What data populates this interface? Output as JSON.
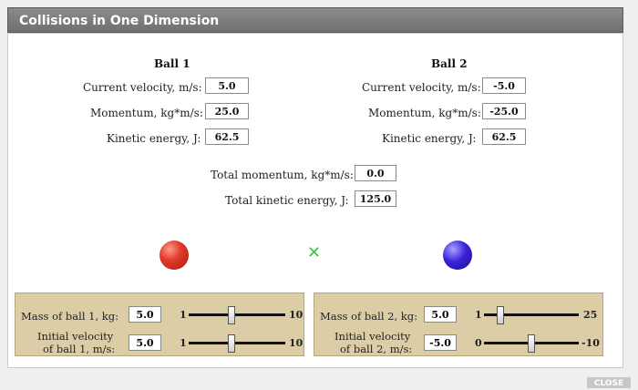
{
  "window": {
    "title": "Collisions in One Dimension"
  },
  "ball1": {
    "header": "Ball 1",
    "velocity_label": "Current velocity, m/s:",
    "velocity": "5.0",
    "momentum_label": "Momentum, kg*m/s:",
    "momentum": "25.0",
    "ke_label": "Kinetic energy, J:",
    "ke": "62.5"
  },
  "ball2": {
    "header": "Ball 2",
    "velocity_label": "Current velocity, m/s:",
    "velocity": "-5.0",
    "momentum_label": "Momentum, kg*m/s:",
    "momentum": "-25.0",
    "ke_label": "Kinetic energy, J:",
    "ke": "62.5"
  },
  "totals": {
    "momentum_label": "Total momentum, kg*m/s:",
    "momentum": "0.0",
    "ke_label": "Total kinetic energy, J:",
    "ke": "125.0"
  },
  "controls1": {
    "mass_label": "Mass of ball 1, kg:",
    "mass": "5.0",
    "mass_min": "1",
    "mass_max": "10",
    "mass_level": 0.44,
    "vel_label_line1": "Initial velocity",
    "vel_label_line2": "of ball 1, m/s:",
    "vel": "5.0",
    "vel_min": "1",
    "vel_max": "10",
    "vel_level": 0.44
  },
  "controls2": {
    "mass_label": "Mass of ball 2, kg:",
    "mass": "5.0",
    "mass_min": "1",
    "mass_max": "25",
    "mass_level": 0.17,
    "vel_label_line1": "Initial velocity",
    "vel_label_line2": "of ball 2, m/s:",
    "vel": "-5.0",
    "vel_min": "0",
    "vel_max": "-10",
    "vel_level": 0.5
  },
  "colors": {
    "ball1": "#e33a2a",
    "ball2": "#3a22d9",
    "marker": "#2ecc2e",
    "control_bg": "#dccda6"
  },
  "icons": {
    "marker": "x-marker-icon"
  },
  "footer": {
    "close_label": "CLOSE"
  }
}
